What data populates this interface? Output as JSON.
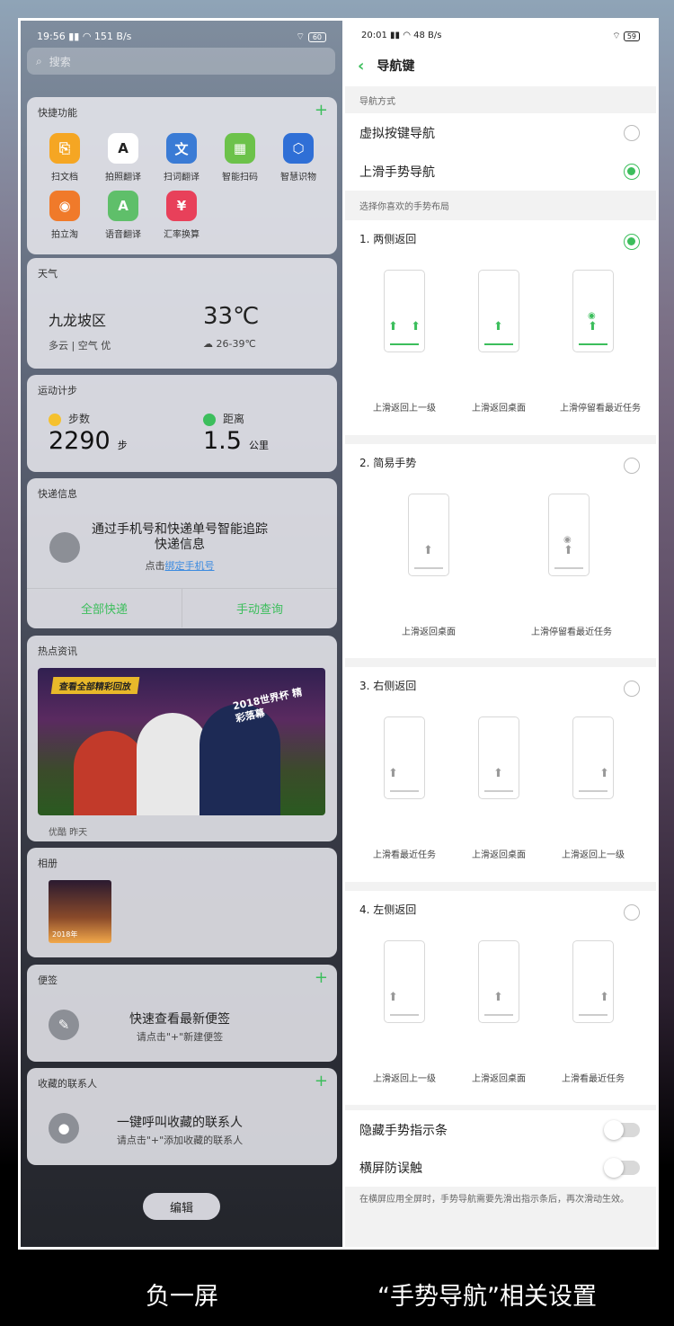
{
  "left": {
    "status": {
      "time": "19:56",
      "net": "151 B/s",
      "battery": "60"
    },
    "search": {
      "placeholder": "搜索"
    },
    "quick": {
      "title": "快捷功能",
      "items": [
        {
          "label": "扫文档",
          "color": "#f5a623"
        },
        {
          "label": "拍照翻译",
          "color": "#ffffff"
        },
        {
          "label": "扫词翻译",
          "color": "#3a7bd5"
        },
        {
          "label": "智能扫码",
          "color": "#6cc24a"
        },
        {
          "label": "智慧识物",
          "color": "#2f6fd6"
        },
        {
          "label": "拍立淘",
          "color": "#f07a2a"
        },
        {
          "label": "语音翻译",
          "color": "#5fbf6a"
        },
        {
          "label": "汇率换算",
          "color": "#e8405a"
        }
      ]
    },
    "weather": {
      "title": "天气",
      "city": "九龙坡区",
      "condition": "多云 | 空气 优",
      "temp": "33℃",
      "range": "26-39℃"
    },
    "steps": {
      "title": "运动计步",
      "steps_label": "步数",
      "steps_value": "2290",
      "steps_unit": "步",
      "dist_label": "距离",
      "dist_value": "1.5",
      "dist_unit": "公里"
    },
    "express": {
      "title": "快递信息",
      "line1": "通过手机号和快递单号智能追踪快递信息",
      "line2_prefix": "点击",
      "line2_link": "绑定手机号",
      "btn_all": "全部快递",
      "btn_manual": "手动查询"
    },
    "news": {
      "title": "热点资讯",
      "banner": "查看全部精彩回放",
      "headline": "2018世界杯 精彩落幕",
      "source": "优酷 昨天"
    },
    "album": {
      "title": "相册",
      "date": "2018年"
    },
    "note": {
      "title": "便签",
      "line1": "快速查看最新便签",
      "line2": "请点击\"+\"新建便签"
    },
    "contacts": {
      "title": "收藏的联系人",
      "line1": "一键呼叫收藏的联系人",
      "line2": "请点击\"+\"添加收藏的联系人"
    },
    "edit": "编辑"
  },
  "right": {
    "status": {
      "time": "20:01",
      "net": "48 B/s",
      "battery": "59"
    },
    "title": "导航键",
    "nav_mode_label": "导航方式",
    "nav_virtual": "虚拟按键导航",
    "nav_gesture": "上滑手势导航",
    "layout_label": "选择你喜欢的手势布局",
    "layouts": [
      {
        "title": "1. 两侧返回",
        "caps": [
          "上滑返回上一级",
          "上滑返回桌面",
          "上滑停留看最近任务"
        ]
      },
      {
        "title": "2. 简易手势",
        "caps": [
          "上滑返回桌面",
          "上滑停留看最近任务"
        ]
      },
      {
        "title": "3. 右侧返回",
        "caps": [
          "上滑看最近任务",
          "上滑返回桌面",
          "上滑返回上一级"
        ]
      },
      {
        "title": "4. 左侧返回",
        "caps": [
          "上滑返回上一级",
          "上滑返回桌面",
          "上滑看最近任务"
        ]
      }
    ],
    "hide_bar": "隐藏手势指示条",
    "landscape": "横屏防误触",
    "footer": "在横屏应用全屏时，手势导航需要先滑出指示条后，再次滑动生效。"
  },
  "captions": {
    "left": "负一屏",
    "right": "“手势导航”相关设置"
  },
  "accent": "#3cbe5c"
}
